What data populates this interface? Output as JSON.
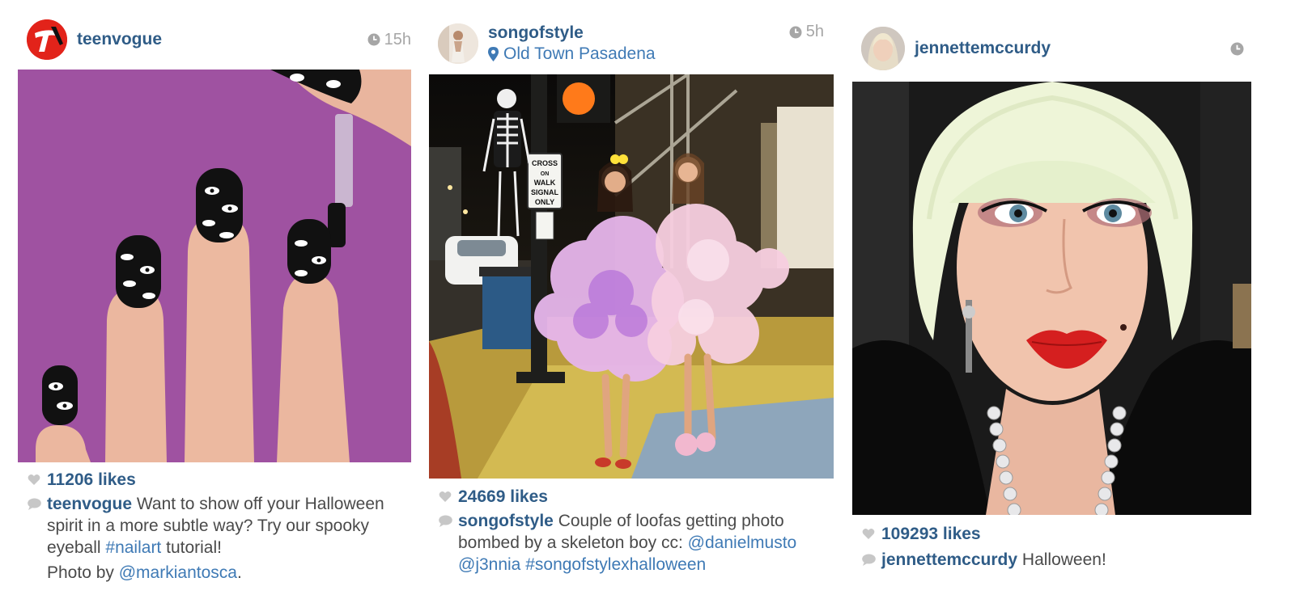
{
  "posts": [
    {
      "username": "teenvogue",
      "time": "15h",
      "likes": "11206 likes",
      "caption": {
        "user": "teenvogue",
        "t1": " Want to show off your Halloween spirit in a more subtle way? Try our spooky eyeball ",
        "tag1": "#nailart",
        "t2": " tutorial!",
        "line2_prefix": "Photo by ",
        "mention": "@markiantosca",
        "line2_suffix": "."
      },
      "photo_icon": "nail-art-photo"
    },
    {
      "username": "songofstyle",
      "location": "Old Town Pasadena",
      "time": "5h",
      "likes": "24669 likes",
      "caption": {
        "user": "songofstyle",
        "t1": " Couple of loofas getting photo bombed by a skeleton boy cc: ",
        "mention1": "@danielmusto",
        "t2": " ",
        "mention2": "@j3nnia",
        "t3": " ",
        "tag1": "#songofstylexhalloween"
      },
      "sign_text": "CROSS ON WALK SIGNAL ONLY",
      "photo_icon": "street-costume-photo"
    },
    {
      "username": "jennettemccurdy",
      "time": "",
      "likes": "109293 likes",
      "caption": {
        "user": "jennettemccurdy",
        "t1": " Halloween!"
      },
      "photo_icon": "selfie-photo"
    }
  ],
  "colors": {
    "username": "#2f5c87",
    "link": "#3f7ab5",
    "text": "#4a4a4a",
    "muted": "#a6a6a6",
    "brand_red": "#e2231a"
  },
  "icons": [
    "clock-icon",
    "heart-icon",
    "comment-icon",
    "location-pin-icon"
  ]
}
